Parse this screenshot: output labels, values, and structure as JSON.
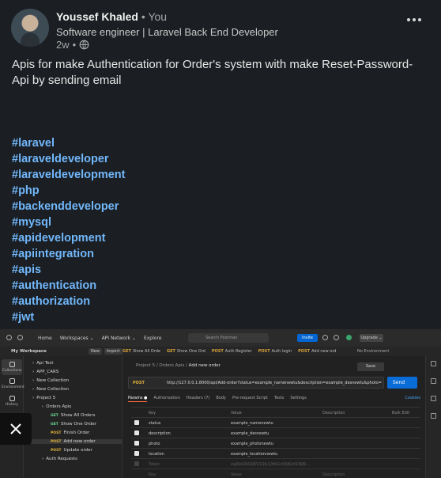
{
  "post": {
    "author_name": "Youssef Khaled",
    "separator": "•",
    "you_label": "You",
    "headline": "Software engineer | Laravel Back End Developer",
    "time": "2w",
    "separator2": "•",
    "body": "Apis for make Authentication for Order's system with make Reset-Password-Api by sending email",
    "hashtags": [
      "#laravel",
      "#laraveldeveloper",
      "#laraveldevelopment",
      "#php",
      "#backenddeveloper",
      "#mysql",
      "#apidevelopment",
      "#apiintegration",
      "#apis",
      "#authentication",
      "#authorization",
      "#jwt"
    ],
    "icons": {
      "globe": "globe-icon",
      "more": "more-icon",
      "close": "close-icon"
    }
  },
  "screenshot": {
    "topbar": {
      "nav": [
        "Home",
        "Workspaces ⌄",
        "API Network ⌄",
        "Explore"
      ],
      "search": "Search Postman",
      "invite": "Invite",
      "upgrade": "Upgrade ⌄"
    },
    "workspace": {
      "name": "My Workspace",
      "new_label": "New",
      "import_label": "Import",
      "tabs": [
        {
          "method": "GET",
          "name": "Show All Orde"
        },
        {
          "method": "GET",
          "name": "Show One Ord"
        },
        {
          "method": "POST",
          "name": "Auth Register"
        },
        {
          "method": "POST",
          "name": "Auth login"
        },
        {
          "method": "POST",
          "name": "Add new ord"
        }
      ],
      "environment": "No Environment"
    },
    "rail": [
      "Collections",
      "Environments",
      "History"
    ],
    "tree": [
      {
        "label": "Api Test",
        "method": ""
      },
      {
        "label": "APP_CARS",
        "method": ""
      },
      {
        "label": "New Collection",
        "method": ""
      },
      {
        "label": "New Collection",
        "method": ""
      },
      {
        "label": "Project 5",
        "method": ""
      },
      {
        "label": "Orders Apis",
        "method": ""
      },
      {
        "label": "Show All Orders",
        "method": "GET"
      },
      {
        "label": "Show One Order",
        "method": "GET"
      },
      {
        "label": "Finish Order",
        "method": "POST"
      },
      {
        "label": "Add new order",
        "method": "POST"
      },
      {
        "label": "Update order",
        "method": "POST"
      },
      {
        "label": "Auth Requests",
        "method": ""
      }
    ],
    "request": {
      "breadcrumb_parent": "Project 5 / Orders Apis /",
      "breadcrumb_current": "Add new order",
      "save_label": "Save",
      "method": "POST",
      "url": "http://127.0.0.1:8000/api/Add-order?status=example_namenewtu&description=example_desnewtu&photo=example_p...",
      "send_label": "Send",
      "subtabs": [
        "Params ●",
        "Authorization",
        "Headers (7)",
        "Body",
        "Pre-request Script",
        "Tests",
        "Settings"
      ],
      "cookies_label": "Cookies",
      "table_headers": {
        "key": "Key",
        "value": "Value",
        "description": "Description",
        "bulk": "Bulk Edit"
      },
      "params": [
        {
          "key": "status",
          "value": "example_namenewtu"
        },
        {
          "key": "description",
          "value": "example_desnewtu"
        },
        {
          "key": "photo",
          "value": "example_photonewtu"
        },
        {
          "key": "location",
          "value": "example_locationnewtu"
        },
        {
          "key": "Token",
          "value": "eyJ0eXAiOiJKV1QiLCJhbGciOiJIUzI1NiJ9..."
        }
      ],
      "placeholder_row": {
        "key": "Key",
        "value": "Value",
        "description": "Description"
      }
    }
  }
}
